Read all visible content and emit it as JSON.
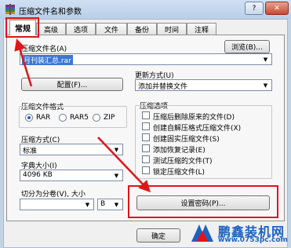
{
  "window": {
    "title": "压缩文件名和参数",
    "help_label": "?",
    "close_label": "✕"
  },
  "tabs": [
    {
      "label": "常规"
    },
    {
      "label": "高级"
    },
    {
      "label": "选项"
    },
    {
      "label": "文件"
    },
    {
      "label": "备份"
    },
    {
      "label": "时间"
    },
    {
      "label": "注释"
    }
  ],
  "archive_name": {
    "label": "压缩文件名(A)",
    "value": "月刊装汇总.rar",
    "browse_label": "浏览(B)..."
  },
  "profiles_button": "配置(F)...",
  "update_mode": {
    "label": "更新方式(U)",
    "value": "添加并替换文件"
  },
  "archive_format": {
    "label": "压缩文件格式",
    "options": [
      "RAR",
      "RAR5",
      "ZIP"
    ],
    "selected": "RAR"
  },
  "compression_method": {
    "label": "压缩方式(C)",
    "value": "标准"
  },
  "dictionary_size": {
    "label": "字典大小(I)",
    "value": "4096 KB"
  },
  "split": {
    "label": "切分为分卷(V), 大小",
    "value": "",
    "unit": "B"
  },
  "archive_options": {
    "label": "压缩选项",
    "items": [
      {
        "label": "压缩后删除原来的文件(D)",
        "checked": false
      },
      {
        "label": "创建自解压格式压缩文件(X)",
        "checked": false
      },
      {
        "label": "创建固实压缩文件(S)",
        "checked": false
      },
      {
        "label": "添加恢复记录(E)",
        "checked": false
      },
      {
        "label": "测试压缩的文件(T)",
        "checked": false
      },
      {
        "label": "锁定压缩文件(L)",
        "checked": false
      }
    ]
  },
  "set_password_button": "设置密码(P)...",
  "ok_button": "确定",
  "watermark": {
    "brand": "鹏鑫装机网",
    "url": "www.0753pc.com"
  },
  "colors": {
    "highlight_red": "#e0151a",
    "selection_blue": "#3a78d4",
    "watermark_blue": "#1b62c4"
  }
}
